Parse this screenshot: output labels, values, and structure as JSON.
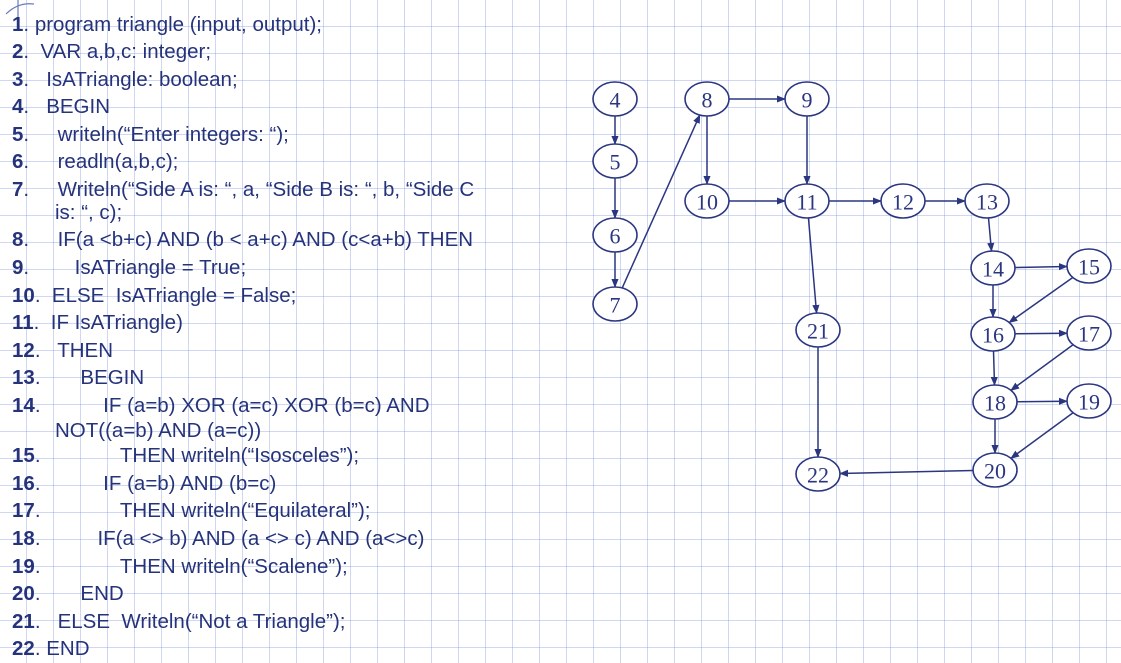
{
  "code_lines": [
    {
      "num": "1",
      "sep": ". ",
      "text": "program triangle (input, output);"
    },
    {
      "num": "2",
      "sep": ".  ",
      "text": "VAR a,b,c: integer;"
    },
    {
      "num": "3",
      "sep": ".   ",
      "text": "IsATriangle: boolean;"
    },
    {
      "num": "4",
      "sep": ".   ",
      "text": "BEGIN"
    },
    {
      "num": "5",
      "sep": ".     ",
      "text": "writeln(“Enter integers: “);"
    },
    {
      "num": "6",
      "sep": ".     ",
      "text": "readln(a,b,c);"
    },
    {
      "num": "7",
      "sep": ".     ",
      "text": "Writeln(“Side A is: “, a, “Side B is: “, b, “Side C"
    },
    {
      "num": "8",
      "sep": ".     ",
      "text": "IF(a <b+c) AND (b < a+c) AND (c<a+b) THEN"
    },
    {
      "num": "9",
      "sep": ".        ",
      "text": "IsATriangle = True;"
    },
    {
      "num": "10",
      "sep": ".  ",
      "text": "ELSE  IsATriangle = False;"
    },
    {
      "num": "11",
      "sep": ".  ",
      "text": "IF IsATriangle)"
    },
    {
      "num": "12",
      "sep": ".   ",
      "text": "THEN"
    },
    {
      "num": "13",
      "sep": ".       ",
      "text": "BEGIN"
    },
    {
      "num": "14",
      "sep": ".           ",
      "text": "IF (a=b) XOR (a=c) XOR (b=c) AND"
    },
    {
      "num": "15",
      "sep": ".              ",
      "text": "THEN writeln(“Isosceles”);"
    },
    {
      "num": "16",
      "sep": ".           ",
      "text": "IF (a=b) AND (b=c)"
    },
    {
      "num": "17",
      "sep": ".              ",
      "text": "THEN writeln(“Equilateral”);"
    },
    {
      "num": "18",
      "sep": ".          ",
      "text": "IF(a <> b) AND (a <> c) AND (a<>c)"
    },
    {
      "num": "19",
      "sep": ".              ",
      "text": "THEN writeln(“Scalene”);"
    },
    {
      "num": "20",
      "sep": ".       ",
      "text": "END"
    },
    {
      "num": "21",
      "sep": ".   ",
      "text": "ELSE  Writeln(“Not a Triangle”);"
    },
    {
      "num": "22",
      "sep": ". ",
      "text": "END"
    }
  ],
  "continuations": {
    "line7": "is: “, c);",
    "line14": "NOT((a=b) AND (a=c))"
  },
  "graph": {
    "nodes": [
      "4",
      "5",
      "6",
      "7",
      "8",
      "9",
      "10",
      "11",
      "12",
      "13",
      "14",
      "15",
      "16",
      "17",
      "18",
      "19",
      "20",
      "21",
      "22"
    ],
    "edges": [
      [
        "4",
        "5"
      ],
      [
        "5",
        "6"
      ],
      [
        "6",
        "7"
      ],
      [
        "7",
        "8"
      ],
      [
        "8",
        "9"
      ],
      [
        "8",
        "10"
      ],
      [
        "9",
        "11"
      ],
      [
        "10",
        "11"
      ],
      [
        "11",
        "12"
      ],
      [
        "11",
        "21"
      ],
      [
        "12",
        "13"
      ],
      [
        "13",
        "14"
      ],
      [
        "14",
        "15"
      ],
      [
        "14",
        "16"
      ],
      [
        "15",
        "16"
      ],
      [
        "16",
        "17"
      ],
      [
        "16",
        "18"
      ],
      [
        "17",
        "18"
      ],
      [
        "18",
        "19"
      ],
      [
        "18",
        "20"
      ],
      [
        "19",
        "20"
      ],
      [
        "20",
        "22"
      ],
      [
        "21",
        "22"
      ]
    ]
  },
  "colors": {
    "text": "#25337a",
    "node_stroke": "#2b3680",
    "grid": "#788cdc"
  }
}
